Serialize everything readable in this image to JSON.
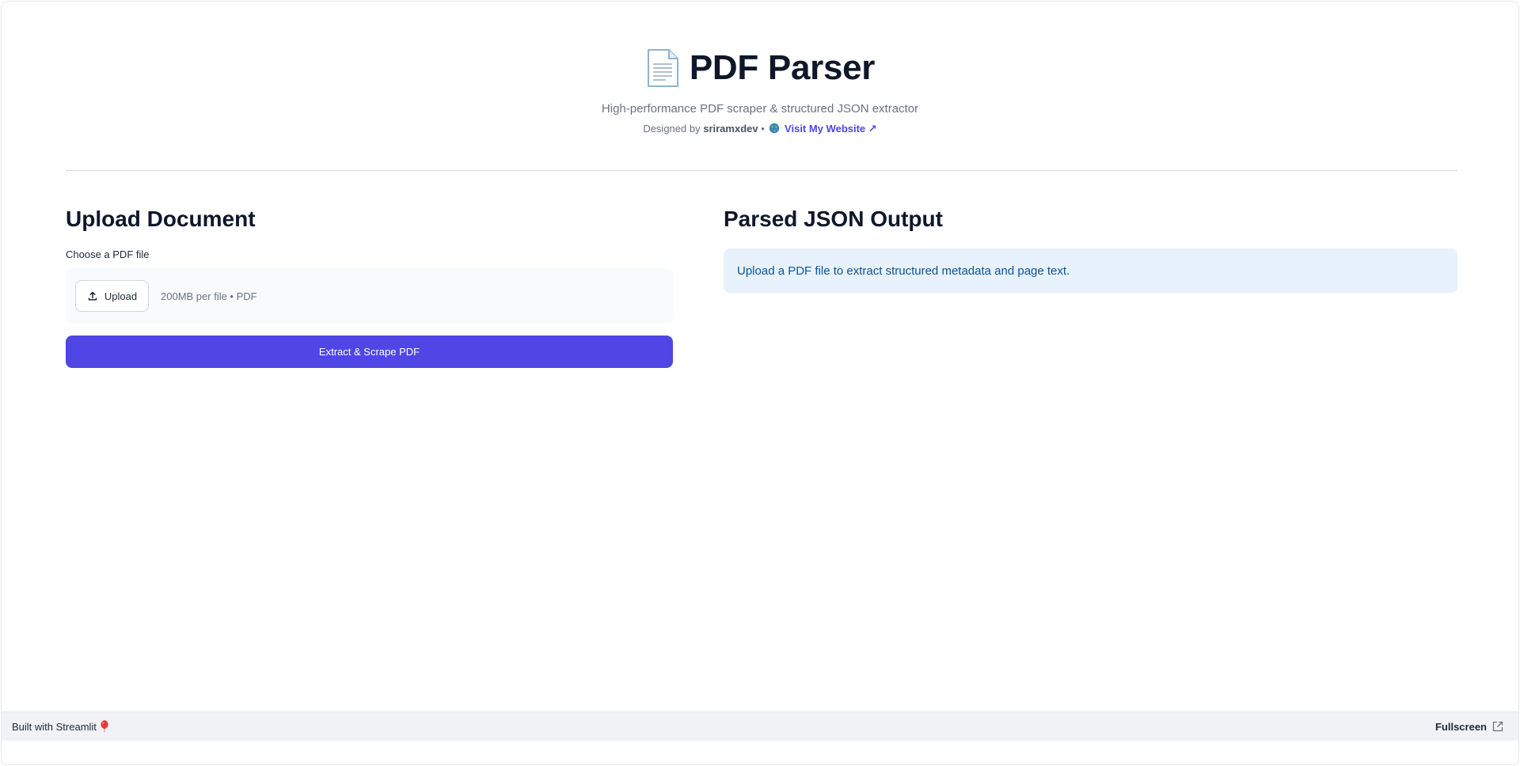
{
  "header": {
    "title": "PDF Parser",
    "icon": "page-document-icon",
    "subtitle": "High-performance PDF scraper & structured JSON extractor",
    "designed_by_prefix": "Designed by",
    "author": "sriramxdev",
    "separator": "•",
    "link_icon": "globe-icon",
    "website_link": "Visit My Website ↗"
  },
  "upload": {
    "section_title": "Upload Document",
    "field_label": "Choose a PDF file",
    "upload_button": "Upload",
    "upload_icon": "upload-icon",
    "hint": "200MB per file • PDF",
    "extract_button": "Extract & Scrape PDF"
  },
  "output": {
    "section_title": "Parsed JSON Output",
    "info_message": "Upload a PDF file to extract structured metadata and page text."
  },
  "footer": {
    "built_with": "Built with Streamlit",
    "balloon_icon": "balloon-icon",
    "fullscreen": "Fullscreen",
    "fullscreen_icon": "external-link-icon"
  },
  "colors": {
    "accent": "#4f46e5",
    "info_bg": "#e8f2fd",
    "info_text": "#0b5394",
    "footer_bg": "#f0f2f6"
  }
}
